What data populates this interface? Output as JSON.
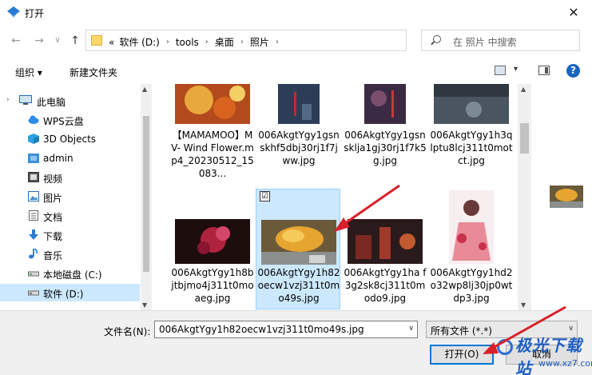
{
  "window": {
    "title": "打开",
    "close_glyph": "✕"
  },
  "nav": {
    "back_glyph": "←",
    "forward_glyph": "→",
    "recent_glyph": "∨",
    "up_glyph": "↑",
    "breadcrumb_prefix": "«",
    "breadcrumbs": [
      "软件 (D:)",
      "tools",
      "桌面",
      "照片"
    ],
    "crumb_sep": "›",
    "address_dropdown_glyph": "∨",
    "refresh_glyph": "↻",
    "search_placeholder": "在 照片 中搜索"
  },
  "toolbar": {
    "organize": "组织 ▾",
    "new_folder": "新建文件夹",
    "view_dd_glyph": "▾",
    "help_glyph": "?"
  },
  "sidebar": {
    "items": [
      {
        "label": "此电脑",
        "icon": "computer-icon"
      },
      {
        "label": "WPS云盘",
        "icon": "cloud-icon"
      },
      {
        "label": "3D Objects",
        "icon": "3d-objects-icon"
      },
      {
        "label": "admin",
        "icon": "user-folder-icon"
      },
      {
        "label": "视频",
        "icon": "video-icon"
      },
      {
        "label": "图片",
        "icon": "pictures-icon"
      },
      {
        "label": "文档",
        "icon": "document-icon"
      },
      {
        "label": "下载",
        "icon": "download-icon"
      },
      {
        "label": "音乐",
        "icon": "music-icon"
      },
      {
        "label": "本地磁盘 (C:)",
        "icon": "drive-icon"
      },
      {
        "label": "软件 (D:)",
        "icon": "drive-icon",
        "selected": true
      }
    ],
    "expand_glyph": "›"
  },
  "files": [
    {
      "name": "【MAMAMOO】MV- Wind Flower.mp4_20230512_15083..."
    },
    {
      "name": "006AkgtYgy1gsnskhf5dbj30rj1f7jww.jpg"
    },
    {
      "name": "006AkgtYgy1gsnsklja1gj30rj1f7k5g.jpg"
    },
    {
      "name": "006AkgtYgy1h3qlptu8lcj311t0motct.jpg"
    },
    {
      "name": "006AkgtYgy1h8bjtbjmo4j311t0moaeg.jpg"
    },
    {
      "name": "006AkgtYgy1h82oecw1vzj311t0mo49s.jpg",
      "selected": true
    },
    {
      "name": "006AkgtYgy1ha f3g2sk8cj311t0modo9.jpg"
    },
    {
      "name": "006AkgtYgy1hd2o32wp8lj30jp0wtdp3.jpg"
    }
  ],
  "checkbox_glyph": "☑",
  "scroll": {
    "up_glyph": "▲",
    "down_glyph": "▼"
  },
  "footer": {
    "filename_label": "文件名(N):",
    "filename_value": "006AkgtYgy1h82oecw1vzj311t0mo49s.jpg",
    "filetype_value": "所有文件 (*.*)",
    "dropdown_glyph": "∨",
    "open_label": "打开(O)",
    "cancel_label": "取消"
  },
  "watermark": {
    "text": "极光下载站",
    "url": "www.xz7.com"
  },
  "colors": {
    "selection": "#cce8ff",
    "accent": "#0078d7",
    "arrow": "#d9202a"
  }
}
